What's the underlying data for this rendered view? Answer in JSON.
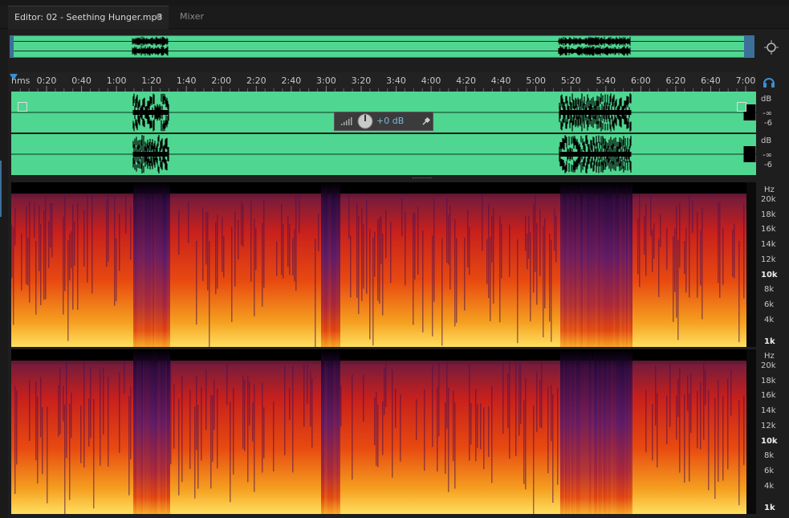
{
  "tabs": {
    "editor_label": "Editor: 02 - Seething Hunger.mp3",
    "menu_glyph": "≡",
    "mixer_label": "Mixer"
  },
  "ruler": {
    "unit": "hms",
    "ticks": [
      "0:20",
      "0:40",
      "1:00",
      "1:20",
      "1:40",
      "2:00",
      "2:20",
      "2:40",
      "3:00",
      "3:20",
      "3:40",
      "4:00",
      "4:20",
      "4:40",
      "5:00",
      "5:20",
      "5:40",
      "6:00",
      "6:20",
      "6:40",
      "7:00"
    ]
  },
  "hud": {
    "volume": "+0 dB"
  },
  "db_scale": {
    "ch1": [
      "dB",
      "-∞",
      "-6"
    ],
    "ch2": [
      "dB",
      "-∞",
      "-6"
    ]
  },
  "hz_scale": {
    "labels": [
      "Hz",
      "20k",
      "18k",
      "16k",
      "14k",
      "12k",
      "10k",
      "8k",
      "6k",
      "4k",
      "1k"
    ]
  },
  "colors": {
    "waveform_bg": "#4fd690",
    "waveform_fg": "#000000",
    "accent": "#3c8fd0"
  },
  "icons": {
    "zoom": "zoom-icon",
    "headphone": "headphone-icon",
    "pin": "pin-icon",
    "knob": "knob-icon"
  }
}
